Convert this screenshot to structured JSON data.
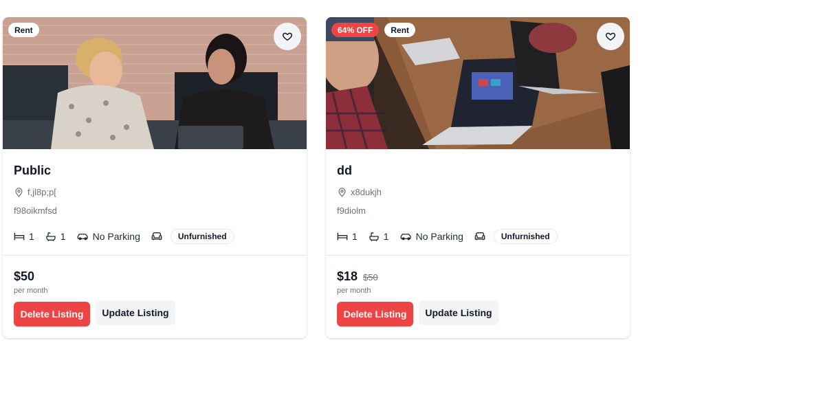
{
  "listings": [
    {
      "type_badge": "Rent",
      "discount_badge": "",
      "name": "Public",
      "address": "f,jl8p;p[",
      "description": "f98oikmfsd",
      "bedrooms": "1",
      "bathrooms": "1",
      "parking": "No Parking",
      "furnished": "Unfurnished",
      "price": "$50",
      "regular_price": "",
      "period": "per month",
      "delete_label": "Delete Listing",
      "update_label": "Update Listing"
    },
    {
      "type_badge": "Rent",
      "discount_badge": "64% OFF",
      "name": "dd",
      "address": "x8dukjh",
      "description": "f9diolm",
      "bedrooms": "1",
      "bathrooms": "1",
      "parking": "No Parking",
      "furnished": "Unfurnished",
      "price": "$18",
      "regular_price": "$50",
      "period": "per month",
      "delete_label": "Delete Listing",
      "update_label": "Update Listing"
    }
  ],
  "colors": {
    "accent": "#ef4444",
    "muted": "#6b7280"
  },
  "icons": [
    "heart-icon",
    "location-pin-icon",
    "bed-icon",
    "bath-icon",
    "car-icon",
    "sofa-icon"
  ]
}
